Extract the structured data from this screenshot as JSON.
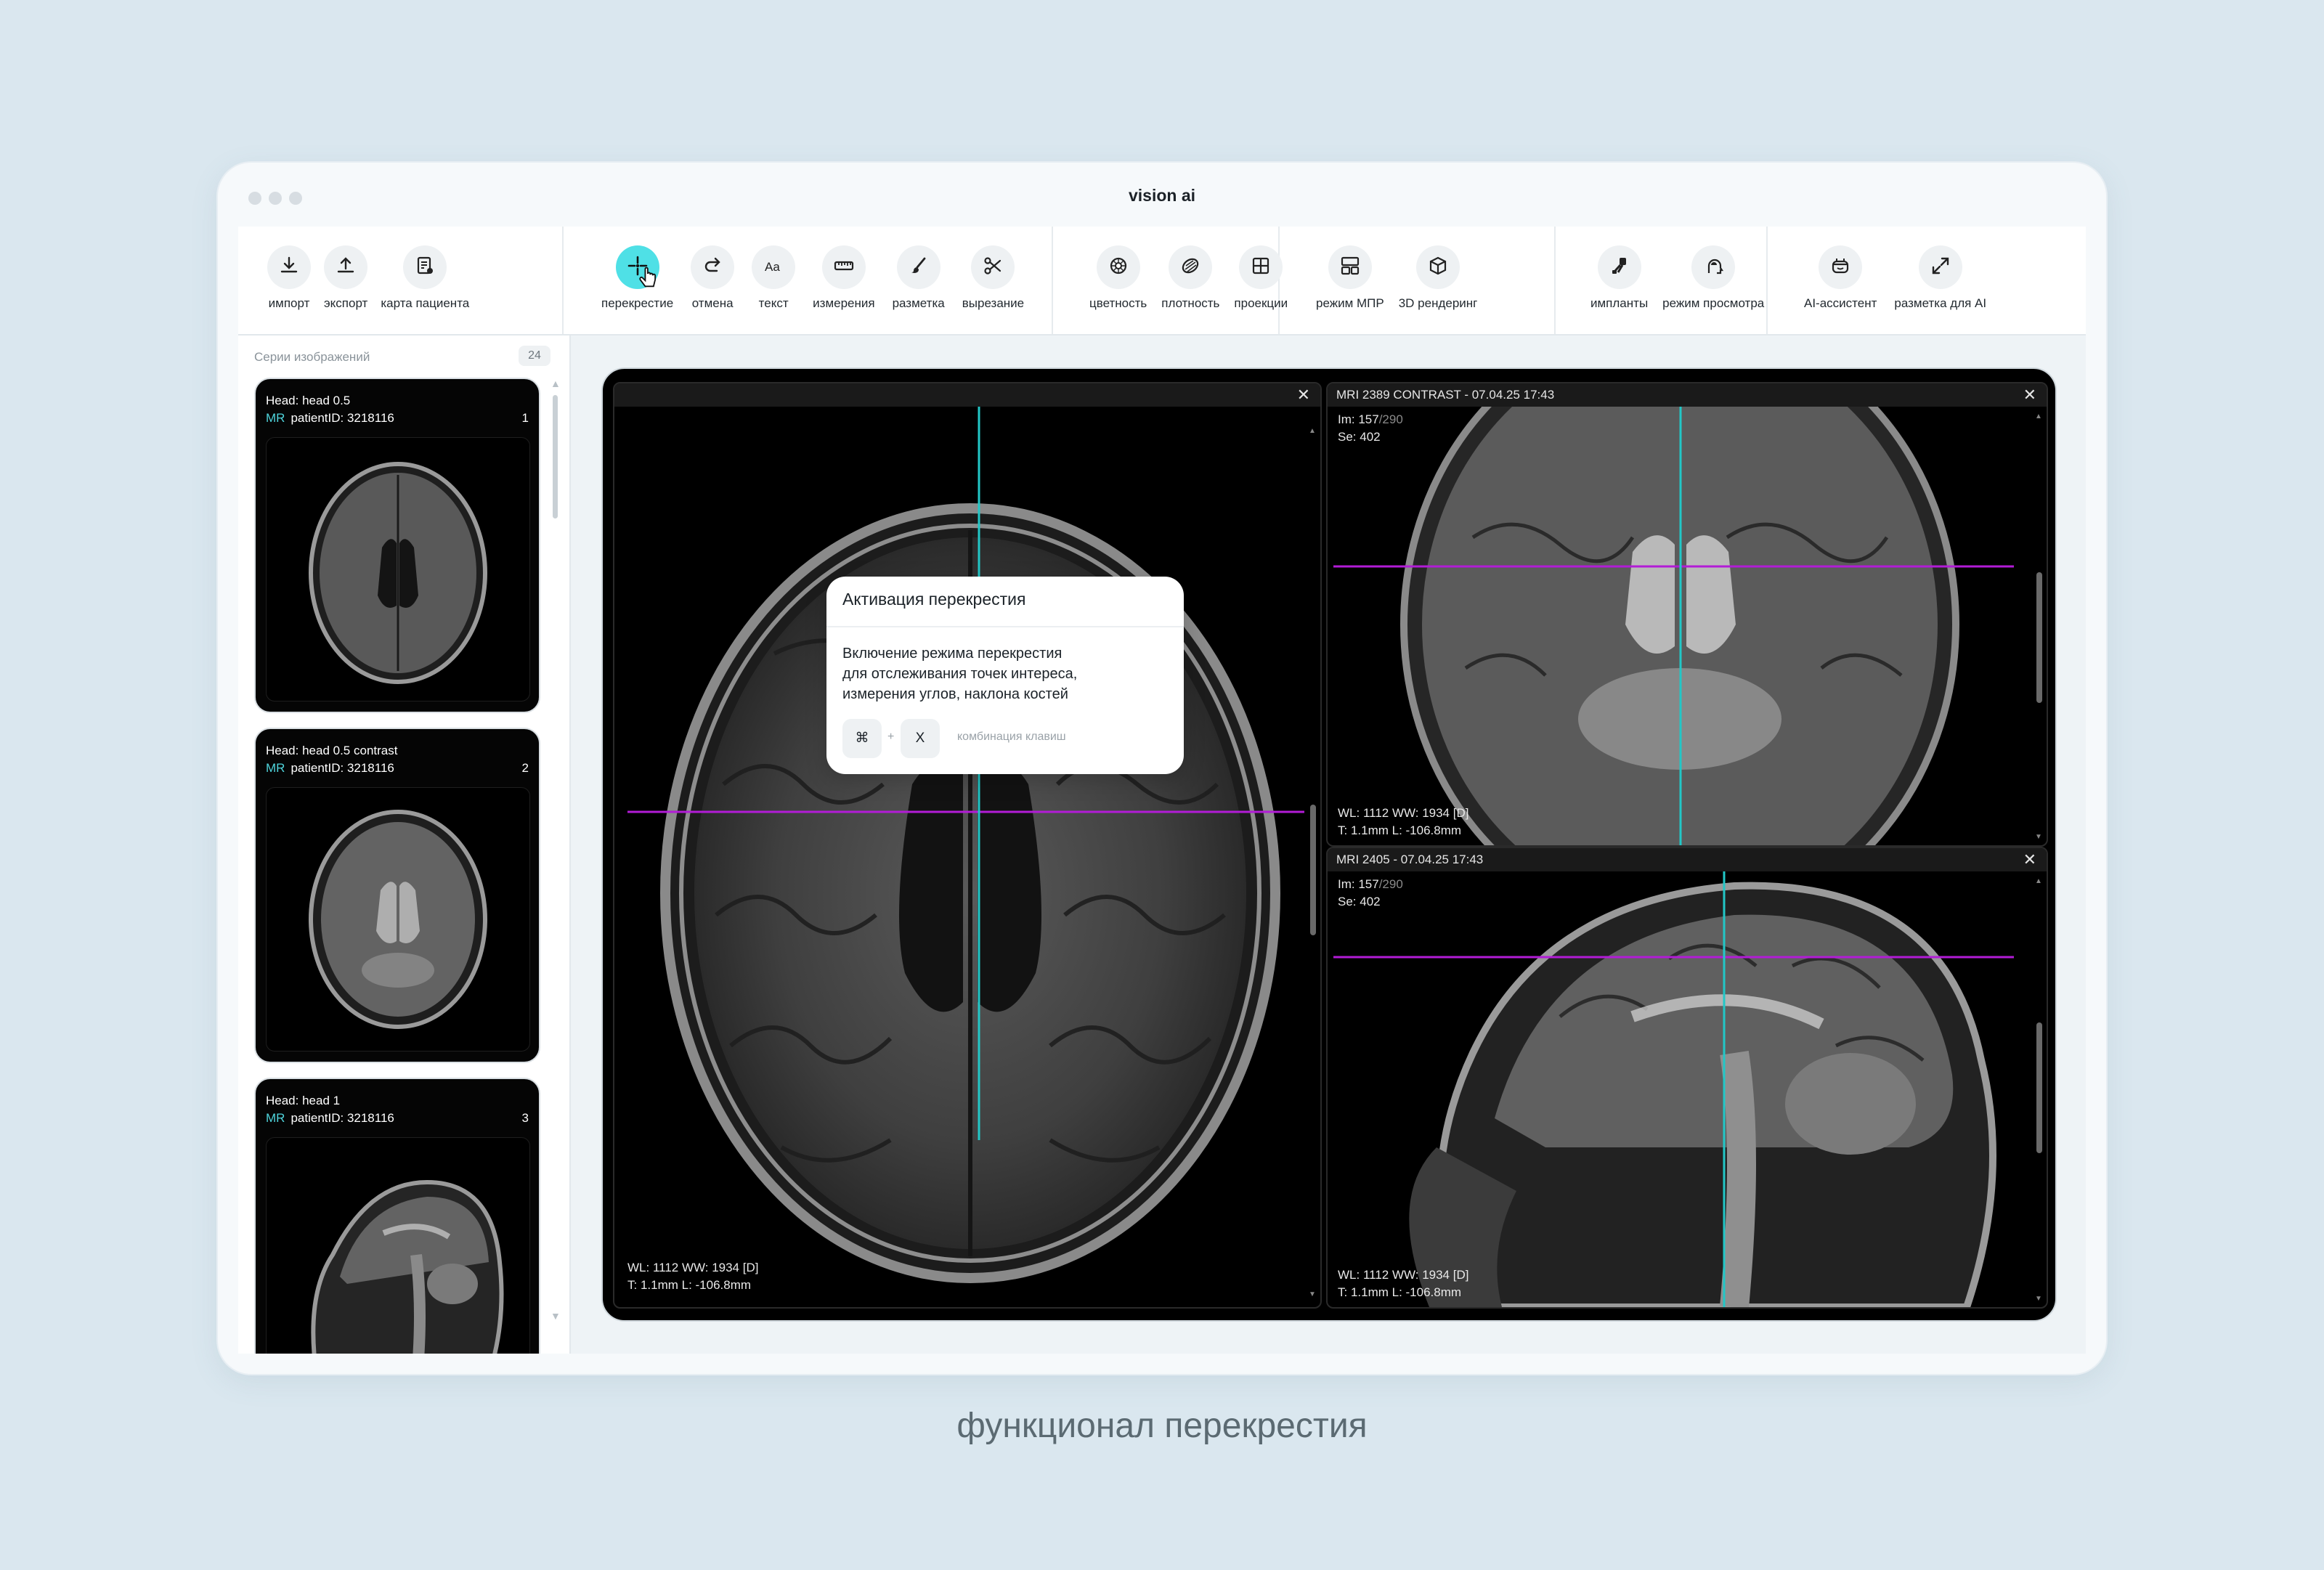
{
  "window": {
    "title": "vision ai"
  },
  "toolbar": {
    "groups": [
      [
        {
          "id": "import",
          "label": "импорт",
          "icon": "download-icon"
        },
        {
          "id": "export",
          "label": "экспорт",
          "icon": "upload-icon"
        },
        {
          "id": "patient",
          "label": "карта пациента",
          "icon": "patient-card-icon"
        }
      ],
      [
        {
          "id": "crosshair",
          "label": "перекрестие",
          "icon": "crosshair-icon",
          "active": true
        },
        {
          "id": "undo",
          "label": "отмена",
          "icon": "redo-arrow-icon"
        },
        {
          "id": "text",
          "label": "текст",
          "icon": "text-aa-icon"
        },
        {
          "id": "measure",
          "label": "измерения",
          "icon": "ruler-icon"
        },
        {
          "id": "markup",
          "label": "разметка",
          "icon": "brush-icon"
        },
        {
          "id": "cut",
          "label": "вырезание",
          "icon": "scissors-icon"
        }
      ],
      [
        {
          "id": "color",
          "label": "цветность",
          "icon": "color-wheel-icon"
        },
        {
          "id": "density",
          "label": "плотность",
          "icon": "density-icon"
        },
        {
          "id": "projections",
          "label": "проекции",
          "icon": "grid-icon"
        }
      ],
      [
        {
          "id": "mpr",
          "label": "режим МПР",
          "icon": "mpr-layout-icon"
        },
        {
          "id": "render3d",
          "label": "3D рендеринг",
          "icon": "cube-icon"
        }
      ],
      [
        {
          "id": "implants",
          "label": "импланты",
          "icon": "implant-icon"
        },
        {
          "id": "viewmode",
          "label": "режим просмотра",
          "icon": "head-view-icon"
        }
      ],
      [
        {
          "id": "ai",
          "label": "AI-ассистент",
          "icon": "robot-icon"
        },
        {
          "id": "ai_markup",
          "label": "разметка для AI",
          "icon": "expand-icon"
        }
      ]
    ]
  },
  "sidebar": {
    "title": "Серии изображений",
    "count": "24",
    "series": [
      {
        "title": "Head:  head 0.5",
        "modality": "MR",
        "patient": "patientID: 3218116",
        "num": "1",
        "view": "axial-flair"
      },
      {
        "title": "Head:  head 0.5 contrast",
        "modality": "MR",
        "patient": "patientID: 3218116",
        "num": "2",
        "view": "axial-t2"
      },
      {
        "title": "Head:  head 1",
        "modality": "MR",
        "patient": "patientID: 3218116",
        "num": "3",
        "view": "sagittal"
      }
    ]
  },
  "viewer": {
    "main": {
      "close": "✕",
      "wl": "WL: 1112   WW: 1934 [D]",
      "tl": "T: 1.1mm   L: -106.8mm"
    },
    "top_right": {
      "title": "MRI 2389 CONTRAST - 07.04.25 17:43",
      "close": "✕",
      "im_cur": "Im: 157",
      "im_total": "/290",
      "se": "Se: 402",
      "wl": "WL: 1112   WW: 1934 [D]",
      "tl": "T: 1.1mm   L: -106.8mm"
    },
    "bottom_right": {
      "title": "MRI 2405 - 07.04.25 17:43",
      "close": "✕",
      "im_cur": "Im: 157",
      "im_total": "/290",
      "se": "Se: 402",
      "wl": "WL: 1112   WW: 1934 [D]",
      "tl": "T: 1.1mm   L: -106.8mm"
    }
  },
  "tooltip": {
    "title": "Активация перекрестия",
    "text_lines": [
      "Включение режима перекрестия",
      "для отслеживания точек интереса,",
      "измерения углов, наклона костей"
    ],
    "key1": "⌘",
    "plus": "+",
    "key2": "X",
    "hint": "комбинация клавиш"
  },
  "caption": "функционал перекрестия",
  "colors": {
    "accent": "#4fe0e6",
    "crosshair_h": "#b21cd6",
    "crosshair_v": "#22c7c7"
  }
}
